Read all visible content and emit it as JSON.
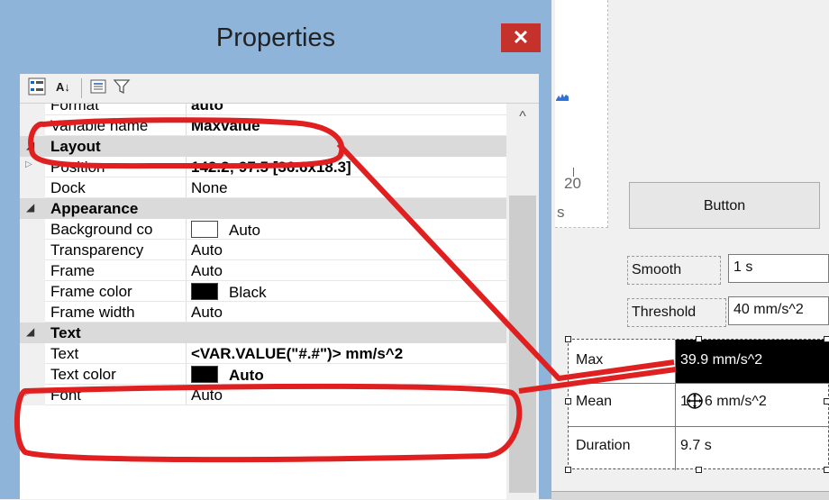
{
  "panel": {
    "title": "Properties",
    "close_glyph": "✕",
    "toolbar": {
      "categorized_icon": "categorized-icon",
      "alphabetical_icon": "alphabetical-icon",
      "alphabetical_glyph": "A↓",
      "property_pages_icon": "property-pages-icon",
      "filter_icon": "filter-icon"
    },
    "rows": [
      {
        "name": "Format",
        "value": "auto",
        "bold": true,
        "partial": true
      },
      {
        "name": "Variable name",
        "value": "Maxvalue",
        "bold": true
      },
      {
        "category": "Layout"
      },
      {
        "name": "Position",
        "value": "142.2; 97.5 [36.6x18.3]",
        "bold": true,
        "expandable": true
      },
      {
        "name": "Dock",
        "value": "None"
      },
      {
        "category": "Appearance"
      },
      {
        "name": "Background co",
        "value": "Auto",
        "swatch": "#ffffff"
      },
      {
        "name": "Transparency",
        "value": "Auto"
      },
      {
        "name": "Frame",
        "value": "Auto"
      },
      {
        "name": "Frame color",
        "value": "Black",
        "swatch": "#000000"
      },
      {
        "name": "Frame width",
        "value": "Auto",
        "partial": true
      },
      {
        "category": "Text"
      },
      {
        "name": "Text",
        "value": "<VAR.VALUE(\"#.#\")> mm/s^2",
        "bold": true
      },
      {
        "name": "Text color",
        "value": "Auto",
        "bold": true,
        "swatch": "#000000",
        "partial": true
      },
      {
        "name": "Font",
        "value": "Auto",
        "expandable": true
      }
    ]
  },
  "designer": {
    "axis_tick_label": "20",
    "axis_unit": "s",
    "button_label": "Button",
    "smooth_label": "Smooth",
    "smooth_value": "1 s",
    "threshold_label": "Threshold",
    "threshold_value": "40 mm/s^2",
    "table": [
      {
        "label": "Max",
        "value": "39.9 mm/s^2",
        "selected": true
      },
      {
        "label": "Mean",
        "value": "1",
        "value_rest": "6 mm/s^2"
      },
      {
        "label": "Duration",
        "value": "9.7 s"
      }
    ]
  },
  "colors": {
    "title_bar": "#8fb4d9",
    "close_button": "#c4322b",
    "annotation_red": "#e02020",
    "category_row": "#dadada",
    "selected_cell": "#000000"
  }
}
